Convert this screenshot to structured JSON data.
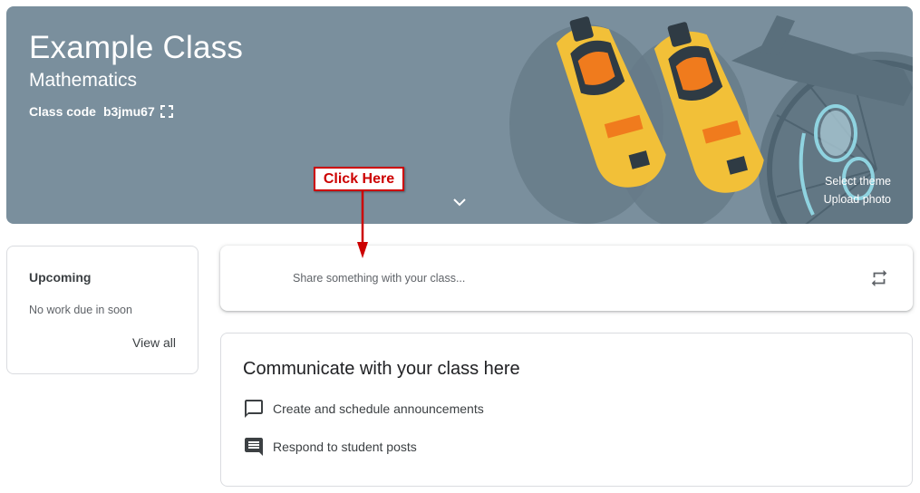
{
  "banner": {
    "class_title": "Example Class",
    "class_subtitle": "Mathematics",
    "class_code_label": "Class code",
    "class_code_value": "b3jmu67",
    "select_theme": "Select theme",
    "upload_photo": "Upload photo",
    "background_color": "#7a8f9d"
  },
  "upcoming": {
    "title": "Upcoming",
    "empty_text": "No work due in soon",
    "view_all": "View all"
  },
  "share": {
    "placeholder": "Share something with your class..."
  },
  "communicate": {
    "title": "Communicate with your class here",
    "items": [
      {
        "label": "Create and schedule announcements",
        "icon": "announcement-icon"
      },
      {
        "label": "Respond to student posts",
        "icon": "comment-icon"
      }
    ]
  },
  "annotation": {
    "label": "Click Here",
    "color": "#cc0000"
  }
}
